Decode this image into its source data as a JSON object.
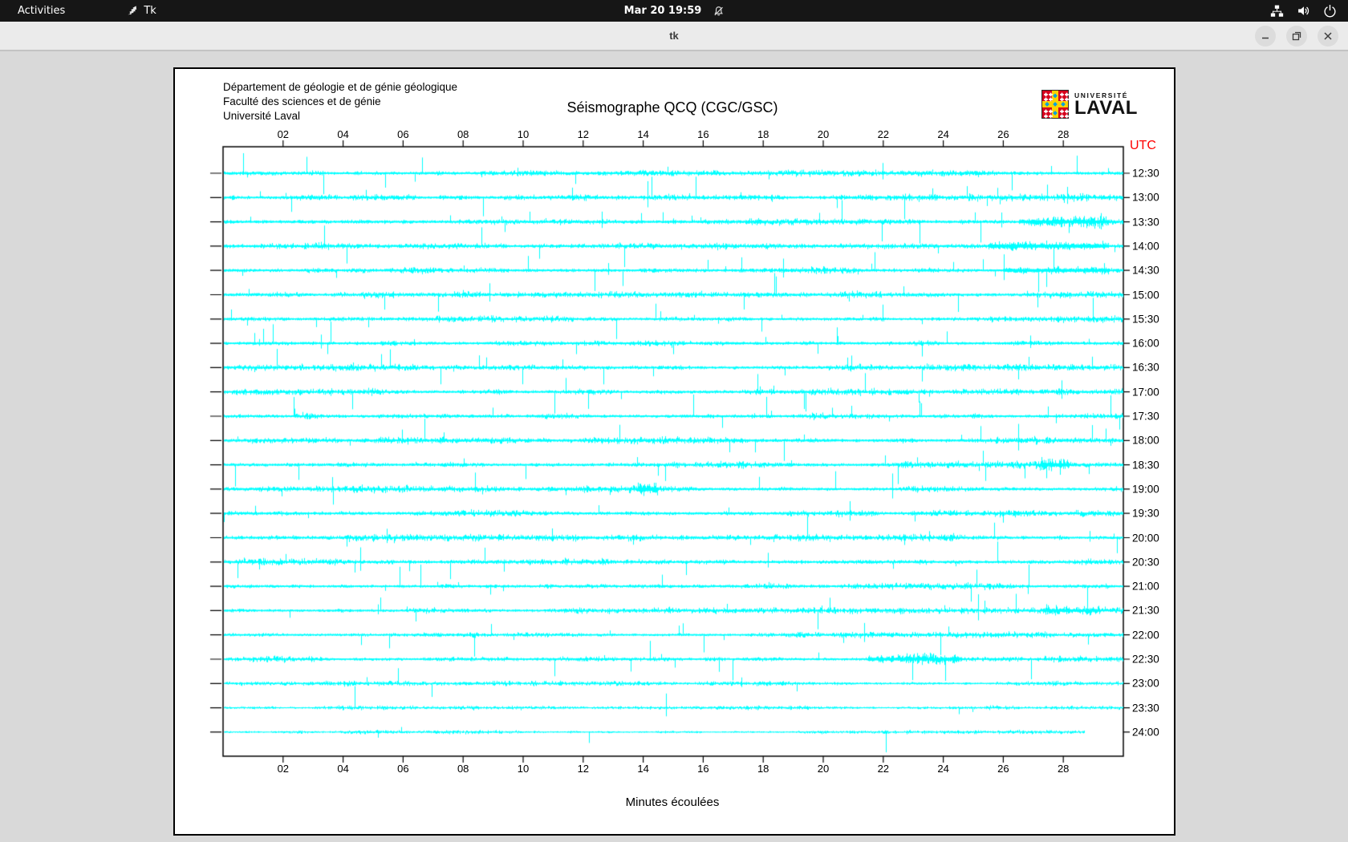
{
  "topbar": {
    "activities_label": "Activities",
    "app_label": "Tk",
    "clock": "Mar 20 19:59"
  },
  "titlebar": {
    "title": "tk"
  },
  "panel": {
    "org_lines": [
      "Département de géologie et de génie géologique",
      "Faculté des sciences et de génie",
      "Université Laval"
    ],
    "title": "Séismographe QCQ (CGC/GSC)",
    "xlabel": "Minutes écoulées",
    "logo": {
      "line1": "UNIVERSITÉ",
      "line2": "LAVAL"
    },
    "chart": {
      "type": "seismograph-helicorder",
      "trace_color": "#00ffff",
      "utc_label": "UTC",
      "utc_color": "#ff0000",
      "x_ticks": [
        "02",
        "04",
        "06",
        "08",
        "10",
        "12",
        "14",
        "16",
        "18",
        "20",
        "22",
        "24",
        "26",
        "28"
      ],
      "x_range_minutes": [
        0,
        30
      ],
      "rows": [
        {
          "label": "12:30",
          "amp": 1.0,
          "spike": 1.0,
          "end": 1,
          "seed": 11,
          "burst": null
        },
        {
          "label": "13:00",
          "amp": 1.0,
          "spike": 1.1,
          "end": 1,
          "seed": 22,
          "burst": null
        },
        {
          "label": "13:30",
          "amp": 1.1,
          "spike": 1.2,
          "end": 1,
          "seed": 33,
          "burst": [
            26.5,
            29.5,
            1.7
          ]
        },
        {
          "label": "14:00",
          "amp": 1.05,
          "spike": 1.0,
          "end": 1,
          "seed": 44,
          "burst": [
            25.5,
            29.5,
            1.9
          ]
        },
        {
          "label": "14:30",
          "amp": 1.0,
          "spike": 1.1,
          "end": 1,
          "seed": 55,
          "burst": [
            26.0,
            29.5,
            1.8
          ]
        },
        {
          "label": "15:00",
          "amp": 1.0,
          "spike": 1.0,
          "end": 1,
          "seed": 66,
          "burst": null
        },
        {
          "label": "15:30",
          "amp": 0.9,
          "spike": 0.95,
          "end": 1,
          "seed": 77,
          "burst": null
        },
        {
          "label": "16:00",
          "amp": 1.0,
          "spike": 1.0,
          "end": 1,
          "seed": 88,
          "burst": null
        },
        {
          "label": "16:30",
          "amp": 0.95,
          "spike": 1.0,
          "end": 1,
          "seed": 99,
          "burst": null
        },
        {
          "label": "17:00",
          "amp": 1.0,
          "spike": 1.1,
          "end": 1,
          "seed": 110,
          "burst": null
        },
        {
          "label": "17:30",
          "amp": 1.0,
          "spike": 1.0,
          "end": 1,
          "seed": 121,
          "burst": null
        },
        {
          "label": "18:00",
          "amp": 1.05,
          "spike": 1.1,
          "end": 1,
          "seed": 132,
          "burst": null
        },
        {
          "label": "18:30",
          "amp": 1.0,
          "spike": 1.0,
          "end": 1,
          "seed": 143,
          "burst": [
            27.2,
            28.2,
            1.9
          ]
        },
        {
          "label": "19:00",
          "amp": 1.0,
          "spike": 1.0,
          "end": 1,
          "seed": 154,
          "burst": [
            13.8,
            14.5,
            2.4
          ]
        },
        {
          "label": "19:30",
          "amp": 1.0,
          "spike": 1.05,
          "end": 1,
          "seed": 165,
          "burst": null
        },
        {
          "label": "20:00",
          "amp": 1.0,
          "spike": 1.05,
          "end": 1,
          "seed": 176,
          "burst": null
        },
        {
          "label": "20:30",
          "amp": 1.0,
          "spike": 1.0,
          "end": 1,
          "seed": 187,
          "burst": null
        },
        {
          "label": "21:00",
          "amp": 0.95,
          "spike": 0.9,
          "end": 1,
          "seed": 198,
          "burst": null
        },
        {
          "label": "21:30",
          "amp": 0.9,
          "spike": 0.85,
          "end": 1,
          "seed": 209,
          "burst": [
            27.3,
            29.2,
            1.8
          ]
        },
        {
          "label": "22:00",
          "amp": 0.9,
          "spike": 0.8,
          "end": 1,
          "seed": 220,
          "burst": null
        },
        {
          "label": "22:30",
          "amp": 0.9,
          "spike": 0.9,
          "end": 1,
          "seed": 231,
          "burst": [
            21.5,
            24.5,
            2.0
          ]
        },
        {
          "label": "23:00",
          "amp": 0.7,
          "spike": 0.35,
          "end": 1,
          "seed": 242,
          "burst": [
            4.0,
            4.4,
            1.6
          ]
        },
        {
          "label": "23:30",
          "amp": 0.6,
          "spike": 0.12,
          "end": 1,
          "seed": 253,
          "burst": null
        },
        {
          "label": "24:00",
          "amp": 0.55,
          "spike": 0.3,
          "end": 0.957,
          "seed": 264,
          "burst": null
        }
      ]
    }
  }
}
